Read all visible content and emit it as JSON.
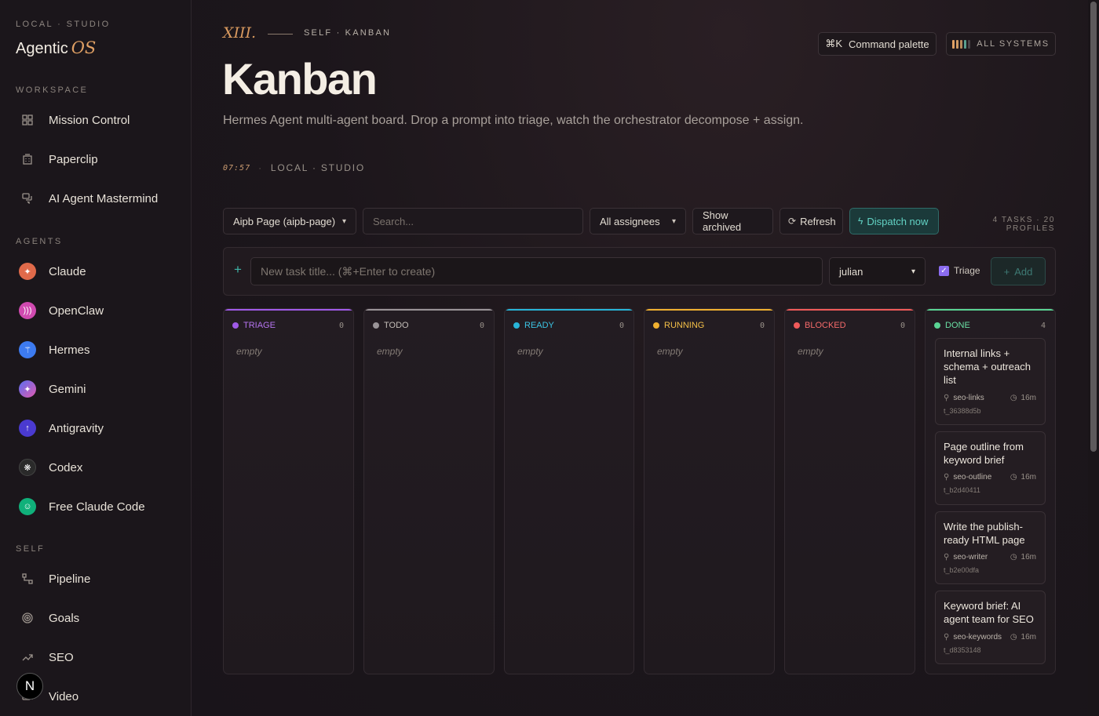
{
  "sidebar": {
    "brand_sub": "LOCAL · STUDIO",
    "brand": "Agentic",
    "brand_os": "OS",
    "sections": {
      "workspace": "WORKSPACE",
      "agents": "AGENTS",
      "self": "SELF"
    },
    "workspace_items": [
      {
        "label": "Mission Control",
        "icon": "grid-icon"
      },
      {
        "label": "Paperclip",
        "icon": "building-icon"
      },
      {
        "label": "AI Agent Mastermind",
        "icon": "chat-icon"
      }
    ],
    "agent_items": [
      {
        "label": "Claude",
        "color": "#e06a4a"
      },
      {
        "label": "OpenClaw",
        "color": "#d04ab0"
      },
      {
        "label": "Hermes",
        "color": "#3d7bf0"
      },
      {
        "label": "Gemini",
        "color": "#8a5ae0"
      },
      {
        "label": "Antigravity",
        "color": "#4a3ad0"
      },
      {
        "label": "Codex",
        "color": "#2a2a2a"
      },
      {
        "label": "Free Claude Code",
        "color": "#10b07a"
      }
    ],
    "self_items": [
      {
        "label": "Pipeline",
        "icon": "pipeline-icon"
      },
      {
        "label": "Goals",
        "icon": "target-icon"
      },
      {
        "label": "SEO",
        "icon": "trend-icon"
      },
      {
        "label": "Video",
        "icon": "video-icon"
      }
    ],
    "logo_letter": "N"
  },
  "header": {
    "numeral": "XIII.",
    "crumb": "SELF · KANBAN",
    "title": "Kanban",
    "description": "Hermes Agent multi-agent board. Drop a prompt into triage, watch the orchestrator decompose + assign.",
    "time": "07:57",
    "location": "LOCAL · STUDIO",
    "command_key": "⌘K",
    "command_label": "Command palette",
    "systems_label": "ALL SYSTEMS"
  },
  "toolbar": {
    "board_select": "Aipb Page (aipb-page)",
    "search_placeholder": "Search...",
    "assignee_select": "All assignees",
    "show_archived": "Show archived",
    "refresh": "Refresh",
    "dispatch": "Dispatch now",
    "counts": "4 TASKS · 20 PROFILES"
  },
  "new_task": {
    "placeholder": "New task title... (⌘+Enter to create)",
    "assignee": "julian",
    "triage_label": "Triage",
    "triage_checked": true,
    "add_label": "Add"
  },
  "columns": [
    {
      "name": "TRIAGE",
      "count": "0",
      "color": "#a05ae8",
      "empty": "empty"
    },
    {
      "name": "TODO",
      "count": "0",
      "color": "#9a9498",
      "empty": "empty"
    },
    {
      "name": "READY",
      "count": "0",
      "color": "#28b4d8",
      "empty": "empty"
    },
    {
      "name": "RUNNING",
      "count": "0",
      "color": "#f0b030",
      "empty": "empty"
    },
    {
      "name": "BLOCKED",
      "count": "0",
      "color": "#f05a5a",
      "empty": "empty"
    },
    {
      "name": "DONE",
      "count": "4",
      "color": "#5ad494",
      "empty": ""
    }
  ],
  "done_cards": [
    {
      "title": "Internal links + schema + outreach list",
      "profile": "seo-links",
      "age": "16m",
      "id": "t_36388d5b"
    },
    {
      "title": "Page outline from keyword brief",
      "profile": "seo-outline",
      "age": "16m",
      "id": "t_b2d40411"
    },
    {
      "title": "Write the publish-ready HTML page",
      "profile": "seo-writer",
      "age": "16m",
      "id": "t_b2e00dfa"
    },
    {
      "title": "Keyword brief: AI agent team for SEO",
      "profile": "seo-keywords",
      "age": "16m",
      "id": "t_d8353148"
    }
  ]
}
